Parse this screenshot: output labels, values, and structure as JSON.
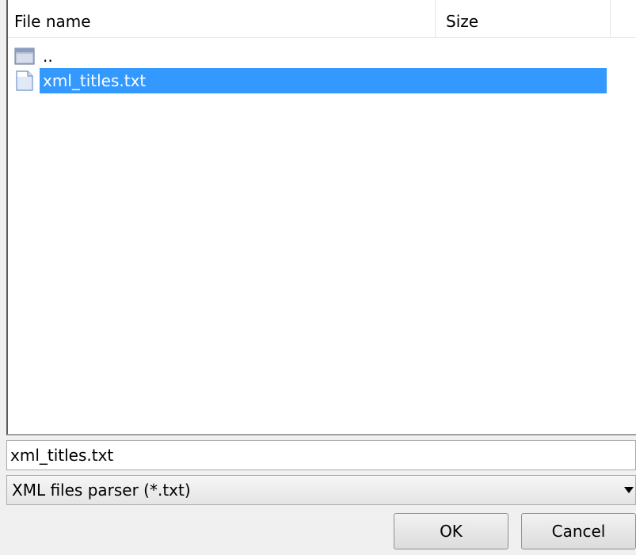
{
  "file_list": {
    "columns": {
      "name": "File name",
      "size": "Size"
    },
    "rows": [
      {
        "icon": "folder-icon",
        "name": "..",
        "size": ""
      },
      {
        "icon": "text-file-icon",
        "name": "xml_titles.txt",
        "size": "",
        "selected": true
      }
    ]
  },
  "filename_input": {
    "value": "xml_titles.txt"
  },
  "filter_select": {
    "selected": "XML files parser (*.txt)",
    "arrow_icon": "chevron-down-icon"
  },
  "buttons": {
    "ok": "OK",
    "cancel": "Cancel"
  },
  "colors": {
    "selection": "#3399ff",
    "selection_text": "#ffffff",
    "dialog_background": "#f0f0f0"
  }
}
